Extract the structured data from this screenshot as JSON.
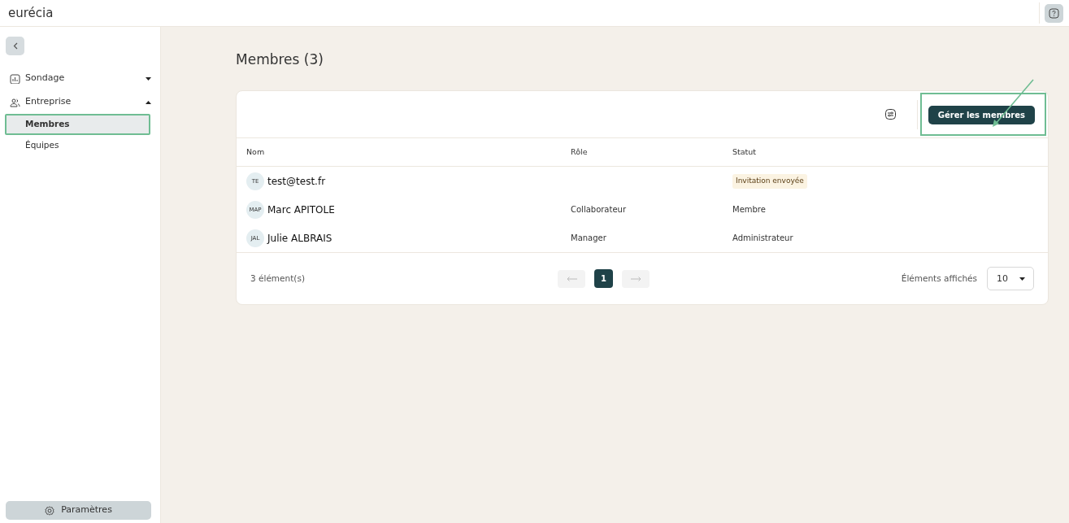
{
  "topbar": {
    "logo": "eurécia"
  },
  "sidebar": {
    "items": [
      {
        "label": "Sondage",
        "kind": "survey",
        "expanded": false
      },
      {
        "label": "Entreprise",
        "kind": "company",
        "expanded": true,
        "children": [
          {
            "label": "Membres",
            "selected": true,
            "highlighted": true
          },
          {
            "label": "Équipes",
            "selected": false,
            "highlighted": false
          }
        ]
      }
    ],
    "settings_button": "Paramètres"
  },
  "page_title": "Membres (3)",
  "manage_button": {
    "label": "Gérer les membres",
    "highlighted": true,
    "arrow": true
  },
  "table": {
    "columns": [
      "Nom",
      "Rôle",
      "Statut"
    ],
    "rows": [
      {
        "initials": "TE",
        "name": "test@test.fr",
        "status": "Invitation envoyée",
        "kind": "invited"
      },
      {
        "initials": "MAP",
        "name": "Marc APITOLE",
        "role": "Collaborateur",
        "status": "Membre",
        "kind": "active"
      },
      {
        "initials": "JAL",
        "name": "Julie ALBRAIS",
        "role": "Manager",
        "status": "Administrateur",
        "kind": "active"
      }
    ]
  },
  "footer": {
    "count": "3 élément(s)",
    "pages": [
      {
        "label": "1",
        "selected": true
      }
    ],
    "prev_disabled": true,
    "next_disabled": true,
    "page_size_label": "Éléments affichés",
    "page_size": "10"
  }
}
